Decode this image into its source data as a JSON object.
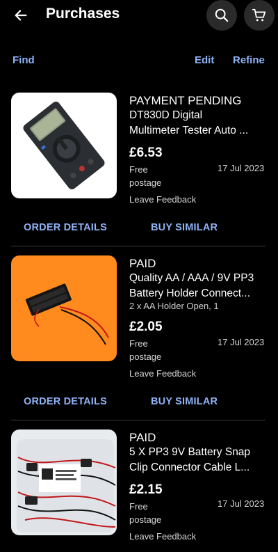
{
  "header": {
    "title": "Purchases",
    "back_icon": "arrow-left-icon",
    "search_icon": "search-icon",
    "cart_icon": "cart-icon"
  },
  "toolbar": {
    "find": "Find",
    "edit": "Edit",
    "refine": "Refine"
  },
  "items": [
    {
      "status": "PAYMENT PENDING",
      "title_line1": "DT830D Digital",
      "title_line2": "Multimeter Tester Auto ...",
      "variant": "",
      "price": "£6.53",
      "postage_line1": "Free",
      "postage_line2": "postage",
      "date": "17 Jul 2023",
      "feedback": "Leave Feedback",
      "order_details": "ORDER DETAILS",
      "buy_similar": "BUY SIMILAR"
    },
    {
      "status": "PAID",
      "title_line1": "Quality AA / AAA / 9V PP3",
      "title_line2": "Battery Holder Connect...",
      "variant": "2 x AA Holder Open, 1",
      "price": "£2.05",
      "postage_line1": "Free",
      "postage_line2": "postage",
      "date": "17 Jul 2023",
      "feedback": "Leave Feedback",
      "order_details": "ORDER DETAILS",
      "buy_similar": "BUY SIMILAR"
    },
    {
      "status": "PAID",
      "title_line1": "5 X PP3 9V Battery Snap",
      "title_line2": "Clip Connector Cable L...",
      "variant": "",
      "price": "£2.15",
      "postage_line1": "Free",
      "postage_line2": "postage",
      "date": "17 Jul 2023",
      "feedback": "Leave Feedback"
    }
  ],
  "colors": {
    "background": "#000000",
    "link": "#8fb3f7",
    "divider": "#3a3a3a",
    "thumb_orange": "#ff8a1e"
  }
}
